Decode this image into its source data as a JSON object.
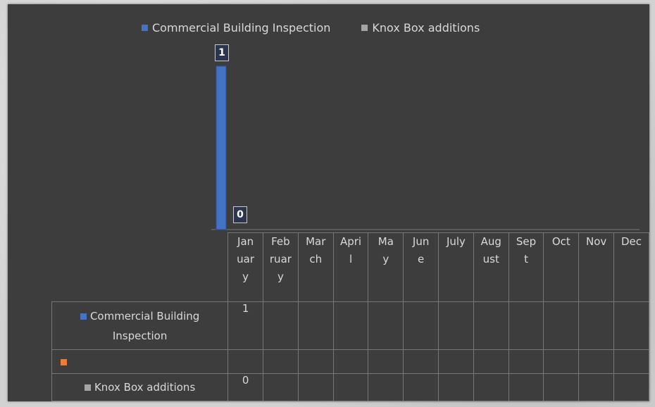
{
  "chart_data": {
    "type": "bar",
    "categories": [
      "Jan uar y",
      "Feb ruar y",
      "Mar ch",
      "Apri l",
      "Ma y",
      "Jun e",
      "July",
      "Aug ust",
      "Sep t",
      "Oct",
      "Nov",
      "Dec"
    ],
    "category_lines": [
      [
        "Jan",
        "uar",
        "y"
      ],
      [
        "Feb",
        "ruar",
        "y"
      ],
      [
        "Mar",
        "ch"
      ],
      [
        "Apri",
        "l"
      ],
      [
        "Ma",
        "y"
      ],
      [
        "Jun",
        "e"
      ],
      [
        "July"
      ],
      [
        "Aug",
        "ust"
      ],
      [
        "Sep",
        "t"
      ],
      [
        "Oct"
      ],
      [
        "Nov"
      ],
      [
        "Dec"
      ]
    ],
    "series": [
      {
        "name": "Commercial Building Inspection",
        "color": "#4472c4",
        "values": [
          1,
          null,
          null,
          null,
          null,
          null,
          null,
          null,
          null,
          null,
          null,
          null
        ]
      },
      {
        "name": "",
        "color": "#ed7d31",
        "values": [
          null,
          null,
          null,
          null,
          null,
          null,
          null,
          null,
          null,
          null,
          null,
          null
        ]
      },
      {
        "name": "Knox Box additions",
        "color": "#a5a5a5",
        "values": [
          0,
          null,
          null,
          null,
          null,
          null,
          null,
          null,
          null,
          null,
          null,
          null
        ]
      }
    ],
    "legend": [
      "Commercial Building Inspection",
      "Knox Box additions"
    ],
    "legend_position": "top",
    "ylim": [
      0,
      1
    ],
    "grid": false,
    "data_table": true
  },
  "legend": {
    "item1": {
      "label": "Commercial Building Inspection",
      "color": "#4472c4"
    },
    "item2": {
      "label": "Knox Box additions",
      "color": "#a5a5a5"
    }
  },
  "table": {
    "row1_label_a": "Commercial Building",
    "row1_label_b": "Inspection",
    "row1_value": "1",
    "row3_label": "Knox Box additions",
    "row3_value": "0"
  },
  "labels": {
    "bar_top": "1",
    "bar_zero": "0"
  }
}
